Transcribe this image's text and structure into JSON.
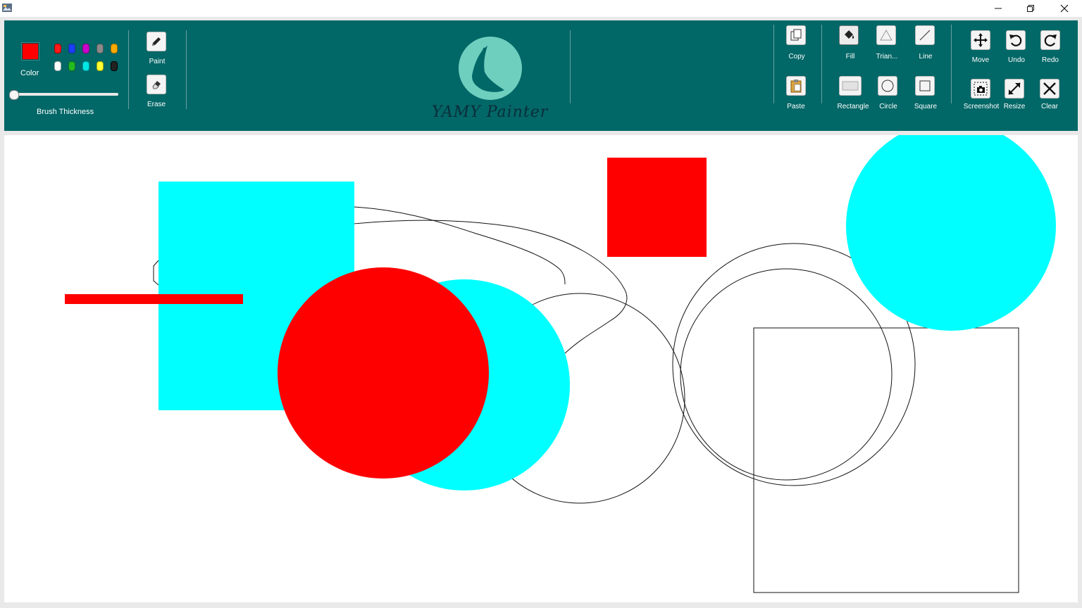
{
  "window": {
    "minimize_icon": "minimize-icon",
    "maximize_icon": "restore-icon",
    "close_icon": "close-icon"
  },
  "toolbar": {
    "color_label": "Color",
    "current_color": "#ff0000",
    "palette_row1": [
      "#ff1a1a",
      "#1a3fff",
      "#cc00cc",
      "#8a8a8a",
      "#ffaa00"
    ],
    "palette_row2": [
      "#ffffff",
      "#22bb22",
      "#00e5e5",
      "#ffff33",
      "#222222"
    ],
    "brush_label": "Brush Thickness",
    "paint_label": "Paint",
    "erase_label": "Erase",
    "logo_text": "YAMY Painter",
    "copy_label": "Copy",
    "paste_label": "Paste",
    "fill_label": "Fill",
    "triangle_label": "Trian...",
    "line_label": "Line",
    "rectangle_label": "Rectangle",
    "circle_label": "Circle",
    "square_label": "Square",
    "move_label": "Move",
    "undo_label": "Undo",
    "redo_label": "Redo",
    "screenshot_label": "Screenshot",
    "resize_label": "Resize",
    "clear_label": "Clear"
  },
  "colors": {
    "toolbar_bg": "#026767",
    "accent_red": "#ff0000",
    "accent_cyan": "#00ffff",
    "logo_teal": "#6fcfbf"
  }
}
